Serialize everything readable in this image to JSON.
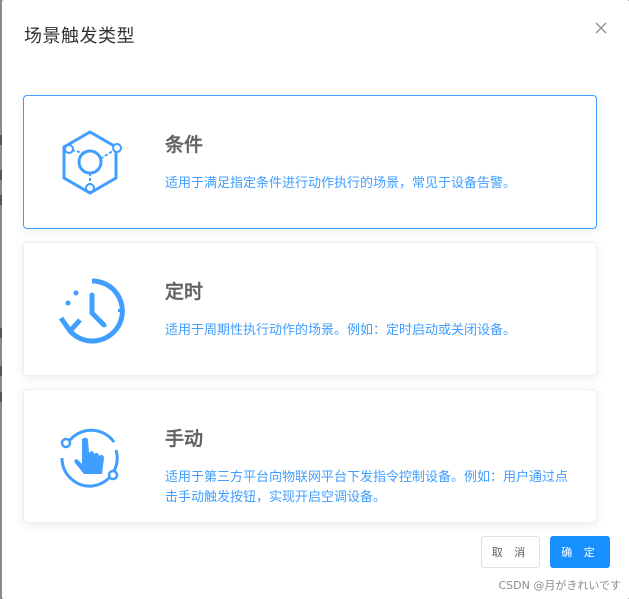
{
  "dialog": {
    "title": "场景触发类型"
  },
  "options": [
    {
      "title": "条件",
      "description": "适用于满足指定条件进行动作执行的场景，常见于设备告警。",
      "icon": "condition-hexagon-icon"
    },
    {
      "title": "定时",
      "description": "适用于周期性执行动作的场景。例如：定时启动或关闭设备。",
      "icon": "timer-clock-icon"
    },
    {
      "title": "手动",
      "description": "适用于第三方平台向物联网平台下发指令控制设备。例如：用户通过点击手动触发按钮，实现开启空调设备。",
      "icon": "manual-hand-icon"
    }
  ],
  "footer": {
    "cancel_label": "取 消",
    "confirm_label": "确 定"
  },
  "watermark": "CSDN @月がきれいです",
  "colors": {
    "primary": "#409eff",
    "button_primary": "#1890ff",
    "title_text": "#303133",
    "option_title": "#606266"
  }
}
